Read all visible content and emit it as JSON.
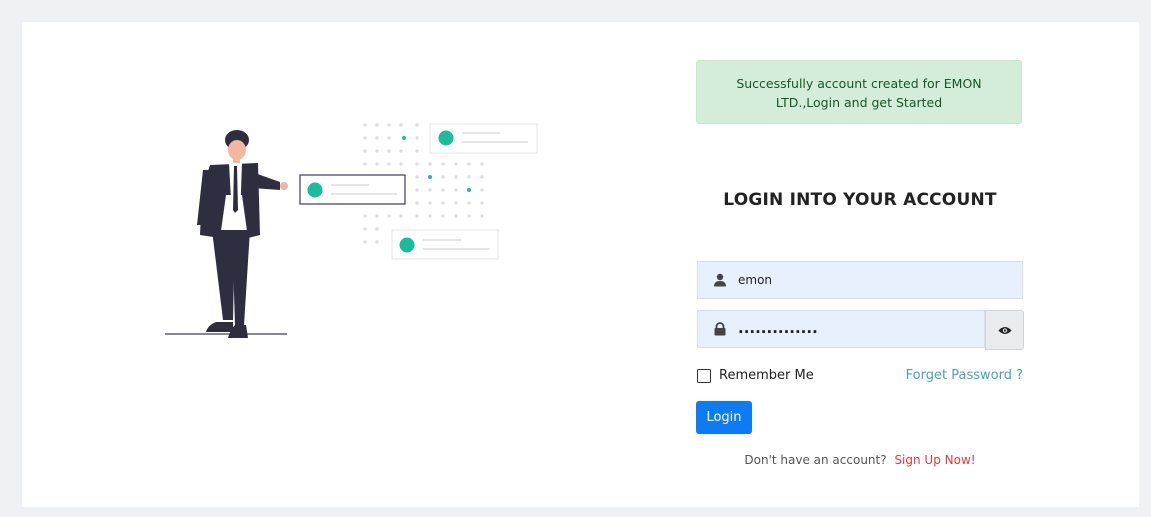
{
  "alert": {
    "message": "Successfully account created for EMON LTD.,Login and get Started"
  },
  "heading": "LOGIN INTO YOUR ACCOUNT",
  "form": {
    "username_value": "emon",
    "password_value": "..............",
    "remember_label": "Remember Me",
    "forgot_label": "Forget Password ?",
    "login_label": "Login",
    "signup_prompt": "Don't have an account?",
    "signup_link": "Sign Up Now!"
  },
  "colors": {
    "primary": "#0d7cf2",
    "accent_teal": "#1bbc9b",
    "alert_bg": "#d4edda",
    "signup_red": "#e0393e",
    "link_blue": "#4aa0c6"
  },
  "icons": [
    "user-icon",
    "lock-icon",
    "eye-icon"
  ]
}
